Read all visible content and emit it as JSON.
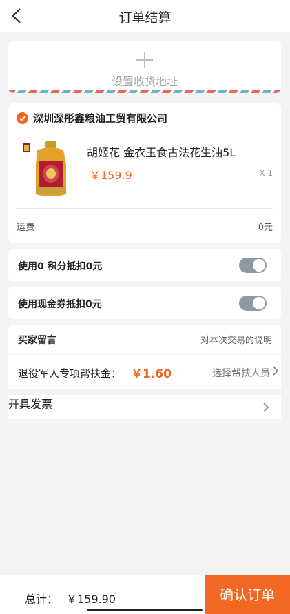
{
  "header": {
    "title": "订单结算",
    "back_icon": "chevron-left-icon"
  },
  "address": {
    "label": "设置收货地址",
    "icon": "plus-icon",
    "stripe_colors": [
      "#e8685a",
      "#6fb2c6"
    ]
  },
  "shop": {
    "name": "深圳深彤鑫粮油工贸有限公司",
    "check_color": "#f26822",
    "product": {
      "name": "胡姬花 金衣玉食古法花生油5L",
      "price": "￥159.9",
      "qty": "X 1"
    },
    "shipping_label": "运费",
    "shipping_value": "0元"
  },
  "points": {
    "label": "使用0 积分抵扣0元"
  },
  "voucher": {
    "label": "使用现金券抵扣0元"
  },
  "message": {
    "label": "买家留言",
    "placeholder": "对本次交易的说明"
  },
  "veteran": {
    "label": "退役军人专项帮扶金：",
    "amount": "￥1.60",
    "select": "选择帮扶人员"
  },
  "invoice": {
    "label": "开具发票"
  },
  "footer": {
    "total_label": "总计：",
    "total_value": "￥159.90",
    "confirm": "确认订单"
  },
  "colors": {
    "accent": "#f26822",
    "toggle": "#8e9aa3"
  }
}
